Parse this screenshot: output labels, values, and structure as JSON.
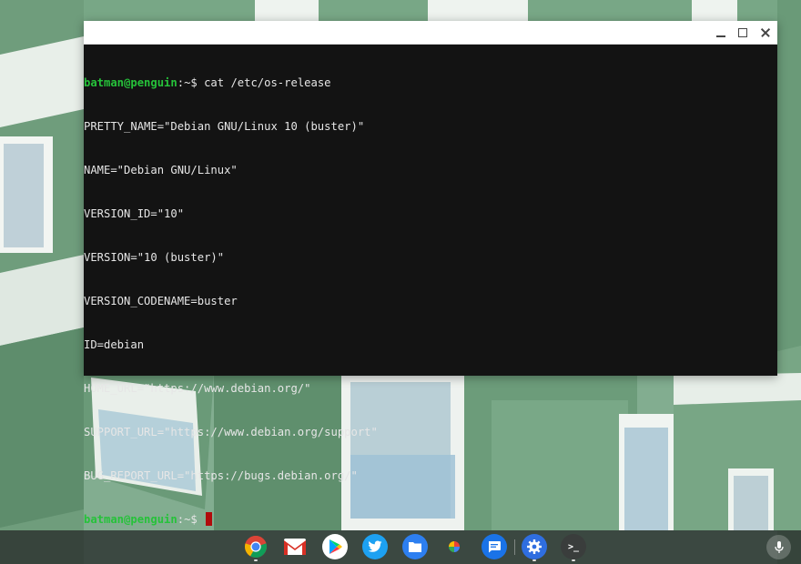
{
  "terminal": {
    "prompt_user": "batman@penguin",
    "prompt_suffix": ":~$ ",
    "command": "cat /etc/os-release",
    "output": [
      "PRETTY_NAME=\"Debian GNU/Linux 10 (buster)\"",
      "NAME=\"Debian GNU/Linux\"",
      "VERSION_ID=\"10\"",
      "VERSION=\"10 (buster)\"",
      "VERSION_CODENAME=buster",
      "ID=debian",
      "HOME_URL=\"https://www.debian.org/\"",
      "SUPPORT_URL=\"https://www.debian.org/support\"",
      "BUG_REPORT_URL=\"https://bugs.debian.org/\""
    ]
  },
  "window_controls": [
    "minimize-icon",
    "maximize-icon",
    "close-icon"
  ],
  "shelf": {
    "apps": [
      {
        "name": "chrome-icon"
      },
      {
        "name": "gmail-icon"
      },
      {
        "name": "play-store-icon"
      },
      {
        "name": "twitter-icon"
      },
      {
        "name": "files-icon"
      },
      {
        "name": "photos-icon"
      },
      {
        "name": "messages-icon"
      },
      {
        "name": "settings-icon"
      },
      {
        "name": "terminal-icon",
        "glyph": ">_"
      }
    ],
    "voice": "mic-icon"
  },
  "colors": {
    "terminal_bg": "#131313",
    "prompt_green": "#26c23a",
    "cursor_red": "#b00c0c",
    "wallpaper_green": "#7aa98a"
  }
}
